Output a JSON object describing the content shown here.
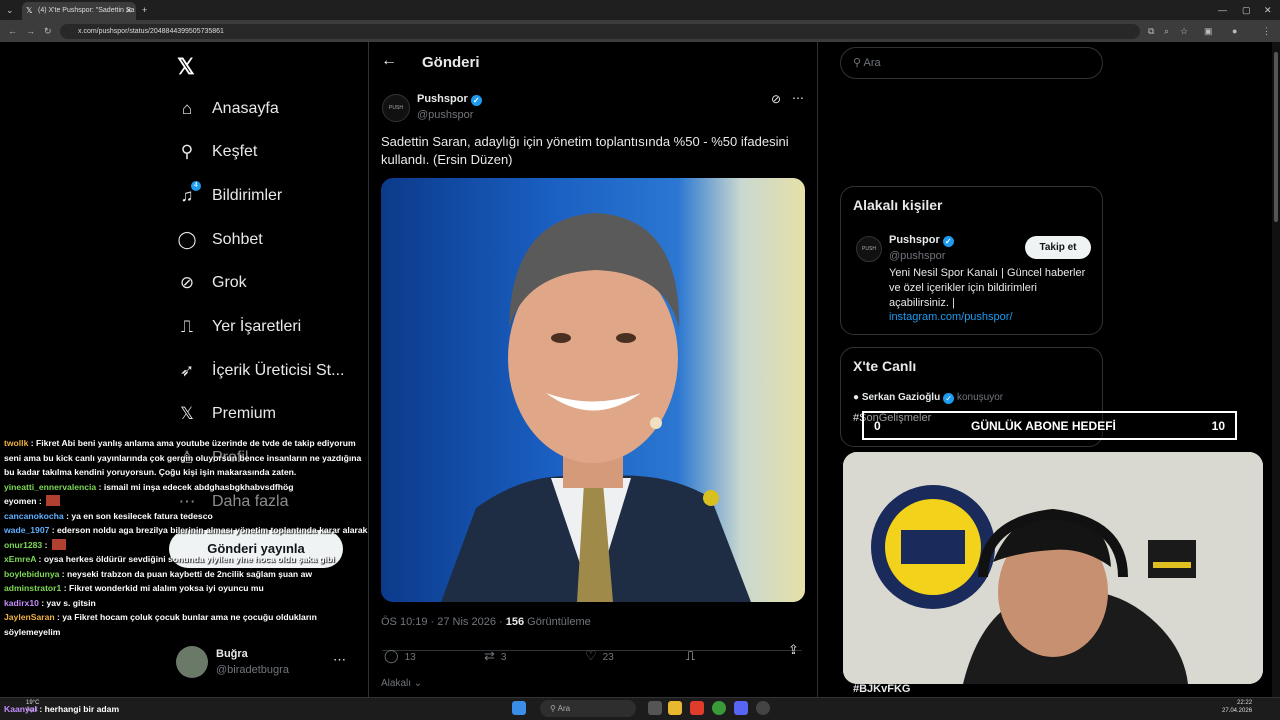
{
  "browser": {
    "tab_title": "(4) X'te Pushspor: \"Sadettin Sa",
    "url": "x.com/pushspor/status/2048844399505735861"
  },
  "nav": {
    "items": [
      {
        "label": "Anasayfa",
        "icon": "home-icon"
      },
      {
        "label": "Keşfet",
        "icon": "search-icon"
      },
      {
        "label": "Bildirimler",
        "icon": "bell-icon",
        "badge": "4"
      },
      {
        "label": "Sohbet",
        "icon": "chat-icon"
      },
      {
        "label": "Grok",
        "icon": "grok-icon"
      },
      {
        "label": "Yer İşaretleri",
        "icon": "bookmark-icon"
      },
      {
        "label": "İçerik Üreticisi St...",
        "icon": "rocket-icon"
      },
      {
        "label": "Premium",
        "icon": "x-icon"
      },
      {
        "label": "Profil",
        "icon": "profile-icon"
      },
      {
        "label": "Daha fazla",
        "icon": "more-icon"
      }
    ],
    "post_button": "Gönderi yayınla",
    "user_name": "Buğra",
    "user_handle": "@biradetbugra"
  },
  "post": {
    "header": "Gönderi",
    "author": "Pushspor",
    "handle": "@pushspor",
    "text": "Sadettin Saran, adaylığı için yönetim toplantısında %50 - %50 ifadesini kullandı. (Ersin Düzen)",
    "time": "ÖS 10:19 · 27 Nis 2026 · ",
    "views": "156",
    "views_label": " Görüntüleme",
    "replies": "13",
    "reposts": "3",
    "likes": "23",
    "relevance": "Alakalı"
  },
  "right": {
    "search_placeholder": "Ara",
    "related_title": "Alakalı kişiler",
    "related_name": "Pushspor",
    "related_handle": "@pushspor",
    "follow_label": "Takip et",
    "related_bio": "Yeni Nesil Spor Kanalı | Güncel haberler ve özel içerikler için bildirimleri açabilirsiniz. |",
    "related_link": "instagram.com/pushspor/",
    "live_title": "X'te Canlı",
    "live_speaker": "Serkan Gazioğlu",
    "live_status": "konuşuyor",
    "live_tag": "#SonGelişmeler",
    "bottom_tag": "#BJKvFKG"
  },
  "overlay": {
    "goal_start": "0",
    "goal_text": "GÜNLÜK ABONE HEDEFİ",
    "goal_end": "10"
  },
  "chat": [
    {
      "user": "twollk",
      "color": "#f0b040",
      "msg": "Fikret Abi beni yanlış anlama ama youtube üzerinde de tvde de takip ediyorum seni ama bu kick canlı yayınlarında çok gergin oluyorsun bence insanların ne yazdığına bu kadar takılma kendini yoruyorsun. Çoğu kişi işin makarasında zaten."
    },
    {
      "user": "yineatti_ennervalencia",
      "color": "#7ed957",
      "msg": "ismail mi inşa edecek abdghasbgkhabvsdfhög"
    },
    {
      "user": "eyomen",
      "color": "#ffffff",
      "msg": ""
    },
    {
      "user": "cancanokocha",
      "color": "#5fb0ff",
      "msg": "ya en son kesilecek fatura tedesco"
    },
    {
      "user": "wade_1907",
      "color": "#5fb0ff",
      "msg": "ederson noldu aga brezilya bilerinin alması yönetim toplantında karar alarak"
    },
    {
      "user": "onur1283",
      "color": "#7ed957",
      "msg": ""
    },
    {
      "user": "xEmreA",
      "color": "#7ed957",
      "msg": "oysa herkes öldürür sevdiğini sonunda yiyilen yine hoca oldu şaka gibi"
    },
    {
      "user": "boylebidunya",
      "color": "#7ed957",
      "msg": "neyseki trabzon da puan kaybetti de 2ncilik sağlam şuan aw"
    },
    {
      "user": "adminstrator1",
      "color": "#7ed957",
      "msg": "Fikret wonderkid mi alalım yoksa iyi oyuncu mu"
    },
    {
      "user": "kadirx10",
      "color": "#c58cff",
      "msg": "yav s. gitsin"
    },
    {
      "user": "JaylenSaran",
      "color": "#f0b040",
      "msg": "ya Fikret hocam çoluk çocuk bunlar ama ne çocuğu oldukların söylemeyelim"
    }
  ],
  "chat_last": {
    "user": "Kaanyal",
    "msg": "herhangi bir adam"
  },
  "taskbar": {
    "weather_temp": "19°C",
    "weather_text": "Açık",
    "search": "Ara",
    "time": "22:22",
    "date": "27.04.2026"
  }
}
